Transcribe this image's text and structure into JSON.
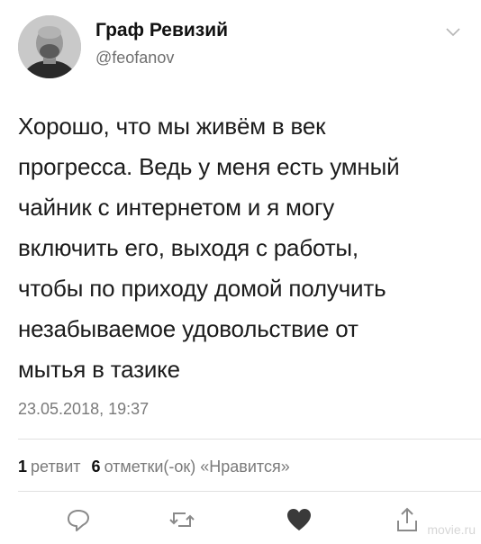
{
  "author": {
    "display_name": "Граф Ревизий",
    "handle": "@feofanov",
    "avatar_icon": "user-avatar"
  },
  "tweet": {
    "lines": [
      "Хорошо, что мы живём в век",
      "прогресса. Ведь у меня есть умный",
      "чайник с интернетом и я могу",
      "включить его, выходя с работы,",
      "чтобы по приходу домой получить",
      "незабываемое удовольствие от",
      "мытья в тазике"
    ],
    "timestamp": "23.05.2018, 19:37"
  },
  "stats": {
    "retweets_count": "1",
    "retweets_label": "ретвит",
    "likes_count": "6",
    "likes_label": "отметки(-ок) «Нравится»"
  },
  "actions": {
    "reply_icon": "reply-icon",
    "retweet_icon": "retweet-icon",
    "like_icon": "heart-icon",
    "share_icon": "share-icon"
  },
  "colors": {
    "like_active": "#3a3a3a",
    "icon_gray": "#8a8a8a"
  },
  "watermark": "movie.ru"
}
